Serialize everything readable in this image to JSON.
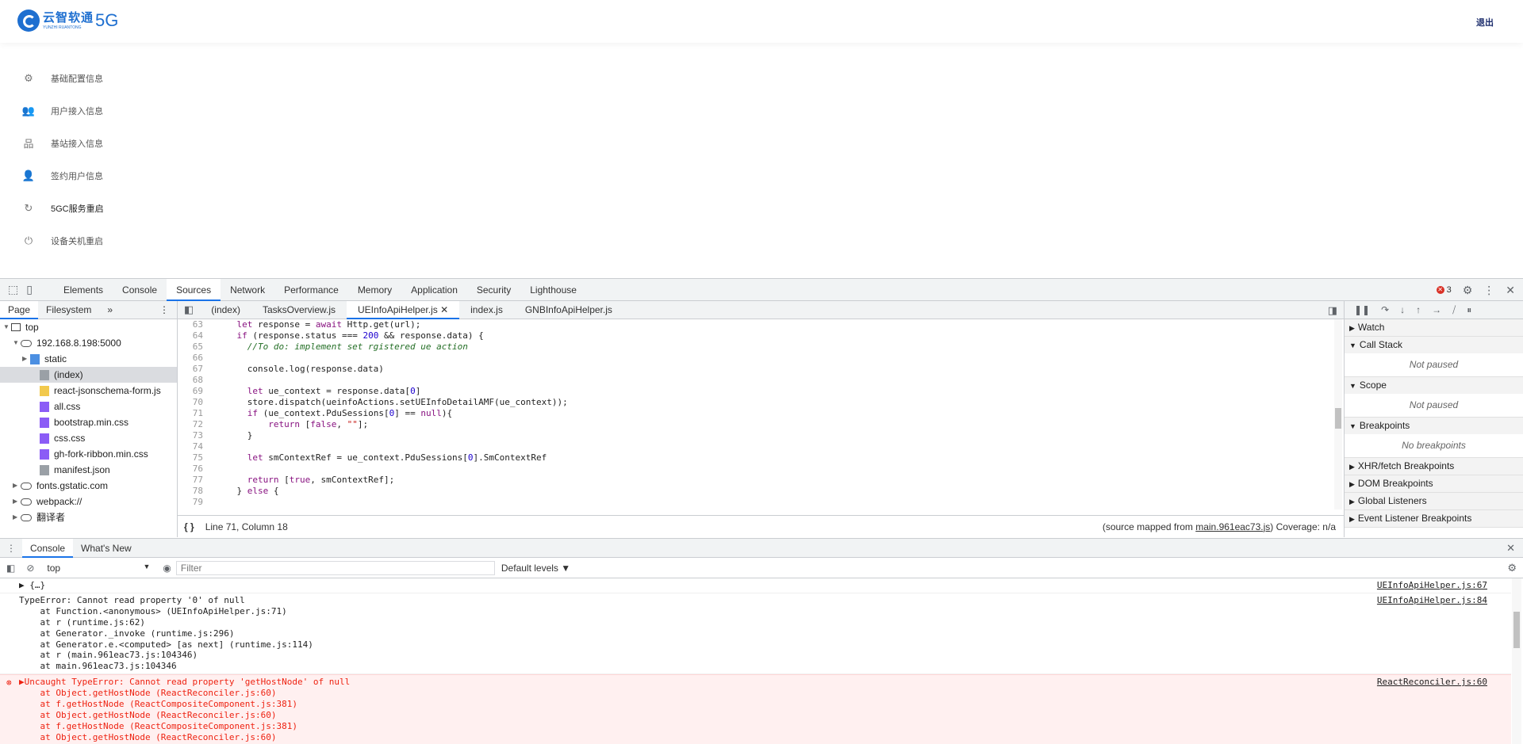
{
  "app": {
    "logo_cn": "云智软通",
    "logo_en": "YUNZHI RUANTONG",
    "logo_5g": "5G",
    "logout": "退出",
    "menu": [
      {
        "label": "基础配置信息",
        "icon": "gear-icon",
        "glyph": "⚙"
      },
      {
        "label": "用户接入信息",
        "icon": "users-icon",
        "glyph": "👥"
      },
      {
        "label": "基站接入信息",
        "icon": "network-icon",
        "glyph": "品"
      },
      {
        "label": "签约用户信息",
        "icon": "user-add-icon",
        "glyph": "👤"
      },
      {
        "label": "5GC服务重启",
        "icon": "refresh-icon",
        "glyph": "↻"
      },
      {
        "label": "设备关机重启",
        "icon": "power-icon",
        "glyph": "⏻"
      }
    ]
  },
  "devtools": {
    "tabs": [
      "Elements",
      "Console",
      "Sources",
      "Network",
      "Performance",
      "Memory",
      "Application",
      "Security",
      "Lighthouse"
    ],
    "active_tab": "Sources",
    "error_count": "3",
    "navigator": {
      "tabs": [
        "Page",
        "Filesystem"
      ],
      "tree": [
        {
          "label": "top",
          "indent": 0,
          "arrow": "▼",
          "type": "frame"
        },
        {
          "label": "192.168.8.198:5000",
          "indent": 1,
          "arrow": "▼",
          "type": "cloud"
        },
        {
          "label": "static",
          "indent": 2,
          "arrow": "▶",
          "type": "folder"
        },
        {
          "label": "(index)",
          "indent": 3,
          "arrow": "",
          "type": "doc",
          "selected": true
        },
        {
          "label": "react-jsonschema-form.js",
          "indent": 3,
          "arrow": "",
          "type": "js"
        },
        {
          "label": "all.css",
          "indent": 3,
          "arrow": "",
          "type": "css"
        },
        {
          "label": "bootstrap.min.css",
          "indent": 3,
          "arrow": "",
          "type": "css"
        },
        {
          "label": "css.css",
          "indent": 3,
          "arrow": "",
          "type": "css"
        },
        {
          "label": "gh-fork-ribbon.min.css",
          "indent": 3,
          "arrow": "",
          "type": "css"
        },
        {
          "label": "manifest.json",
          "indent": 3,
          "arrow": "",
          "type": "doc"
        },
        {
          "label": "fonts.gstatic.com",
          "indent": 1,
          "arrow": "▶",
          "type": "cloud"
        },
        {
          "label": "webpack://",
          "indent": 1,
          "arrow": "▶",
          "type": "cloud"
        },
        {
          "label": "翻译者",
          "indent": 1,
          "arrow": "▶",
          "type": "cloud"
        }
      ]
    },
    "editor_tabs": [
      "(index)",
      "TasksOverview.js",
      "UEInfoApiHelper.js",
      "index.js",
      "GNBInfoApiHelper.js"
    ],
    "active_editor_tab": "UEInfoApiHelper.js",
    "code": [
      {
        "n": "63",
        "t": "    let response = await Http.get(url);"
      },
      {
        "n": "64",
        "t": "    if (response.status === 200 && response.data) {"
      },
      {
        "n": "65",
        "t": "      //To do: implement set rgistered ue action"
      },
      {
        "n": "66",
        "t": ""
      },
      {
        "n": "67",
        "t": "      console.log(response.data)"
      },
      {
        "n": "68",
        "t": ""
      },
      {
        "n": "69",
        "t": "      let ue_context = response.data[0]"
      },
      {
        "n": "70",
        "t": "      store.dispatch(ueinfoActions.setUEInfoDetailAMF(ue_context));"
      },
      {
        "n": "71",
        "t": "      if (ue_context.PduSessions[0] == null){"
      },
      {
        "n": "72",
        "t": "          return [false, \"\"];"
      },
      {
        "n": "73",
        "t": "      }"
      },
      {
        "n": "74",
        "t": ""
      },
      {
        "n": "75",
        "t": "      let smContextRef = ue_context.PduSessions[0].SmContextRef"
      },
      {
        "n": "76",
        "t": ""
      },
      {
        "n": "77",
        "t": "      return [true, smContextRef];"
      },
      {
        "n": "78",
        "t": "    } else {"
      },
      {
        "n": "79",
        "t": ""
      }
    ],
    "status_position": "Line 71, Column 18",
    "status_source_prefix": "(source mapped from ",
    "status_source_link": "main.961eac73.js",
    "status_source_suffix": ") Coverage: n/a",
    "debugger": {
      "panes": [
        {
          "title": "Watch",
          "arrow": "▶",
          "body": ""
        },
        {
          "title": "Call Stack",
          "arrow": "▼",
          "body": "Not paused"
        },
        {
          "title": "Scope",
          "arrow": "▼",
          "body": "Not paused"
        },
        {
          "title": "Breakpoints",
          "arrow": "▼",
          "body": "No breakpoints"
        },
        {
          "title": "XHR/fetch Breakpoints",
          "arrow": "▶",
          "body": ""
        },
        {
          "title": "DOM Breakpoints",
          "arrow": "▶",
          "body": ""
        },
        {
          "title": "Global Listeners",
          "arrow": "▶",
          "body": ""
        },
        {
          "title": "Event Listener Breakpoints",
          "arrow": "▶",
          "body": ""
        }
      ]
    },
    "drawer_tabs": [
      "Console",
      "What's New"
    ],
    "console_context": "top",
    "filter_placeholder": "Filter",
    "levels": "Default levels ▼",
    "messages": [
      {
        "type": "log",
        "lines": [
          "▶ {…}"
        ],
        "source": "UEInfoApiHelper.js:67"
      },
      {
        "type": "log",
        "lines": [
          "TypeError: Cannot read property '0' of null",
          "    at Function.<anonymous> (UEInfoApiHelper.js:71)",
          "    at r (runtime.js:62)",
          "    at Generator._invoke (runtime.js:296)",
          "    at Generator.e.<computed> [as next] (runtime.js:114)",
          "    at r (main.961eac73.js:104346)",
          "    at main.961eac73.js:104346"
        ],
        "source": "UEInfoApiHelper.js:84"
      },
      {
        "type": "error",
        "lines": [
          "▶Uncaught TypeError: Cannot read property 'getHostNode' of null",
          "    at Object.getHostNode (ReactReconciler.js:60)",
          "    at f.getHostNode (ReactCompositeComponent.js:381)",
          "    at Object.getHostNode (ReactReconciler.js:60)",
          "    at f.getHostNode (ReactCompositeComponent.js:381)",
          "    at Object.getHostNode (ReactReconciler.js:60)"
        ],
        "source": "ReactReconciler.js:60"
      }
    ]
  }
}
